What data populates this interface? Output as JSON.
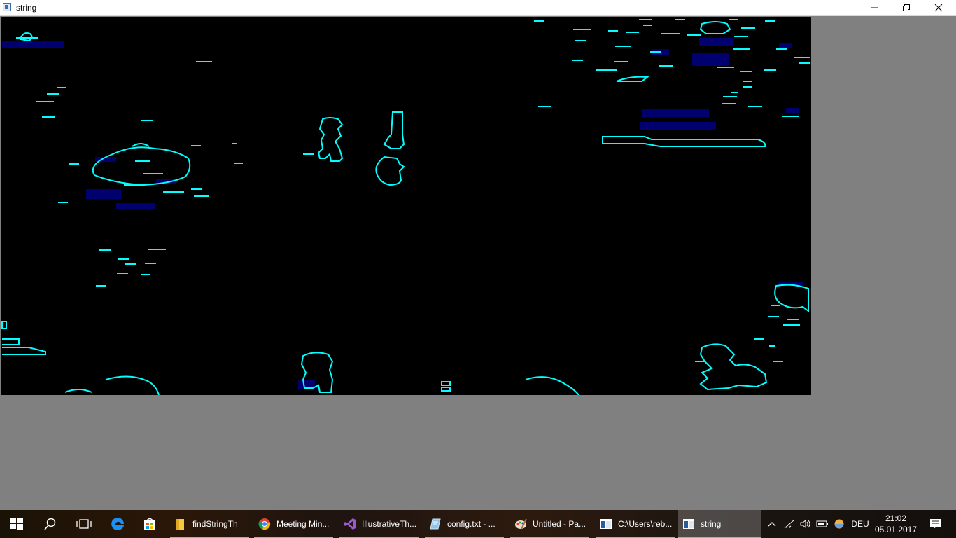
{
  "window": {
    "title": "string",
    "controls": [
      "minimize-icon",
      "restore-icon",
      "close-icon"
    ]
  },
  "canvas": {
    "description_colors": {
      "background": "#000000",
      "contour": "#00ffff",
      "box": "#00006e"
    }
  },
  "taskbar": {
    "start_icon": "windows-logo-icon",
    "search_icon": "search-icon",
    "taskview_icon": "task-view-icon",
    "pinned": [
      {
        "name": "edge",
        "icon": "edge-icon"
      },
      {
        "name": "store",
        "icon": "store-icon"
      }
    ],
    "apps": [
      {
        "label": "findStringTh",
        "icon": "folder-icon",
        "active": false
      },
      {
        "label": "Meeting Min...",
        "icon": "chrome-icon",
        "active": false
      },
      {
        "label": "IllustrativeTh...",
        "icon": "visual-studio-icon",
        "active": false
      },
      {
        "label": "config.txt - ...",
        "icon": "notepad-icon",
        "active": false
      },
      {
        "label": "Untitled - Pa...",
        "icon": "paint-icon",
        "active": false
      },
      {
        "label": "C:\\Users\\reb...",
        "icon": "console-icon",
        "active": false
      },
      {
        "label": "string",
        "icon": "window-app-icon",
        "active": true
      }
    ],
    "tray": {
      "language": "DEU",
      "time": "21:02",
      "date": "05.01.2017",
      "icons": [
        "chevron-up-icon",
        "wifi-icon",
        "volume-icon",
        "battery-icon",
        "app-tray-icon",
        "notifications-icon"
      ]
    }
  },
  "colors": {
    "taskbar_accent": "#76b9ed",
    "titlebar_bg": "#ffffff",
    "desktop_bg": "#808080"
  }
}
